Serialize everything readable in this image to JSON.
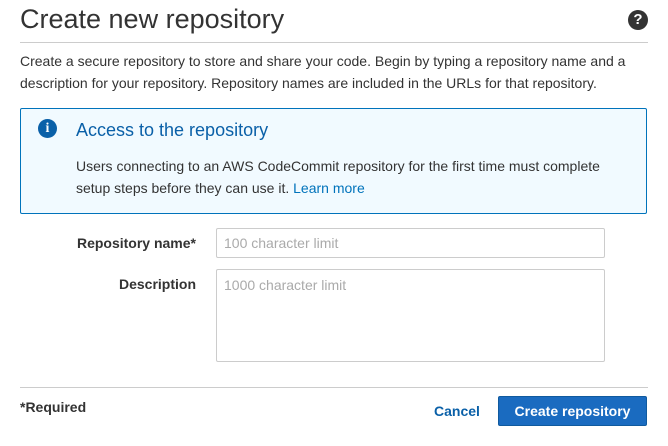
{
  "dialog": {
    "title": "Create new repository",
    "help_icon": "?",
    "intro": "Create a secure repository to store and share your code. Begin by typing a repository name and a description for your repository. Repository names are included in the URLs for that repository."
  },
  "info": {
    "icon": "i",
    "title": "Access to the repository",
    "body": "Users connecting to an AWS CodeCommit repository for the first time must complete setup steps before they can use it.",
    "link": "Learn more"
  },
  "form": {
    "name_label": "Repository name*",
    "name_value": "",
    "name_placeholder": "100 character limit",
    "description_label": "Description",
    "description_value": "",
    "description_placeholder": "1000 character limit"
  },
  "footer": {
    "required_note": "*Required",
    "cancel_label": "Cancel",
    "create_label": "Create repository"
  },
  "colors": {
    "accent": "#0a60a8",
    "primary_button": "#1a6bc0",
    "info_background": "#f1faff",
    "info_border": "#0073bb"
  },
  "icons": {
    "help": "help-icon",
    "info": "info-icon"
  }
}
